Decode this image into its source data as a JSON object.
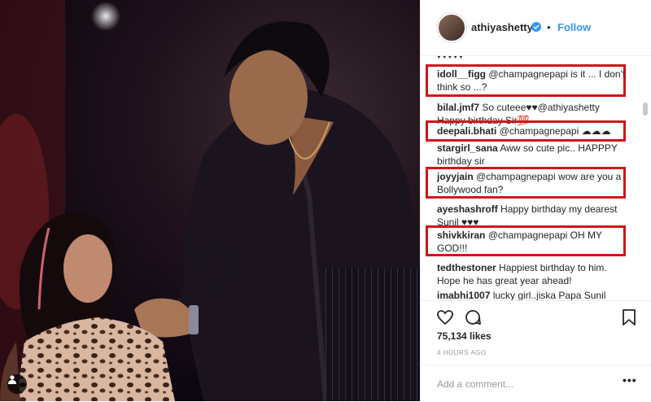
{
  "post": {
    "username": "athiyashetty",
    "follow_label": "Follow",
    "dot_separator": "•",
    "verified": true
  },
  "comments": {
    "top_partial": "♥♥♥♥♥",
    "items": [
      {
        "user": "idoll__figg",
        "line1": " @champagnepapi is it ... I don't",
        "line2": "think so ...?",
        "highlighted": true
      },
      {
        "user": "bilal.jmf7",
        "line1": " So cuteee♥♥@athiyashetty",
        "line2": "Happy birthday Sir💯",
        "highlighted": false
      },
      {
        "user": "deepali.bhati",
        "line1": " @champagnepapi ☁☁☁",
        "line2": "",
        "highlighted": true
      },
      {
        "user": "stargirl_sana",
        "line1": " Aww so cute pic.. HAPPPY",
        "line2": "birthday sir",
        "highlighted": false
      },
      {
        "user": "joyyjain",
        "line1": " @champagnepapi wow are you a",
        "line2": "Bollywood fan?",
        "highlighted": true
      },
      {
        "user": "ayeshashroff",
        "line1": " Happy birthday my dearest",
        "line2": "Sunil ♥♥♥",
        "highlighted": false
      },
      {
        "user": "shivkkiran",
        "line1": " @champagnepapi OH MY",
        "line2": "GOD!!!",
        "highlighted": true
      },
      {
        "user": "tedthestoner",
        "line1": " Happiest birthday to him.",
        "line2": "Hope he has great year ahead!",
        "highlighted": false
      },
      {
        "user": "imabhi1007",
        "line1": " lucky girl..jiska Papa Sunil",
        "line2": "",
        "highlighted": false
      }
    ]
  },
  "actions": {
    "like_icon": "heart-outline-icon",
    "comment_icon": "comment-bubble-icon",
    "save_icon": "bookmark-icon"
  },
  "likes": "75,134 likes",
  "timestamp": "4 HOURS AGO",
  "add_comment": {
    "placeholder": "Add a comment...",
    "more_label": "•••"
  },
  "colors": {
    "highlight_box": "#d0141c",
    "link_blue": "#3897f0",
    "text": "#262626",
    "muted": "#999999"
  }
}
